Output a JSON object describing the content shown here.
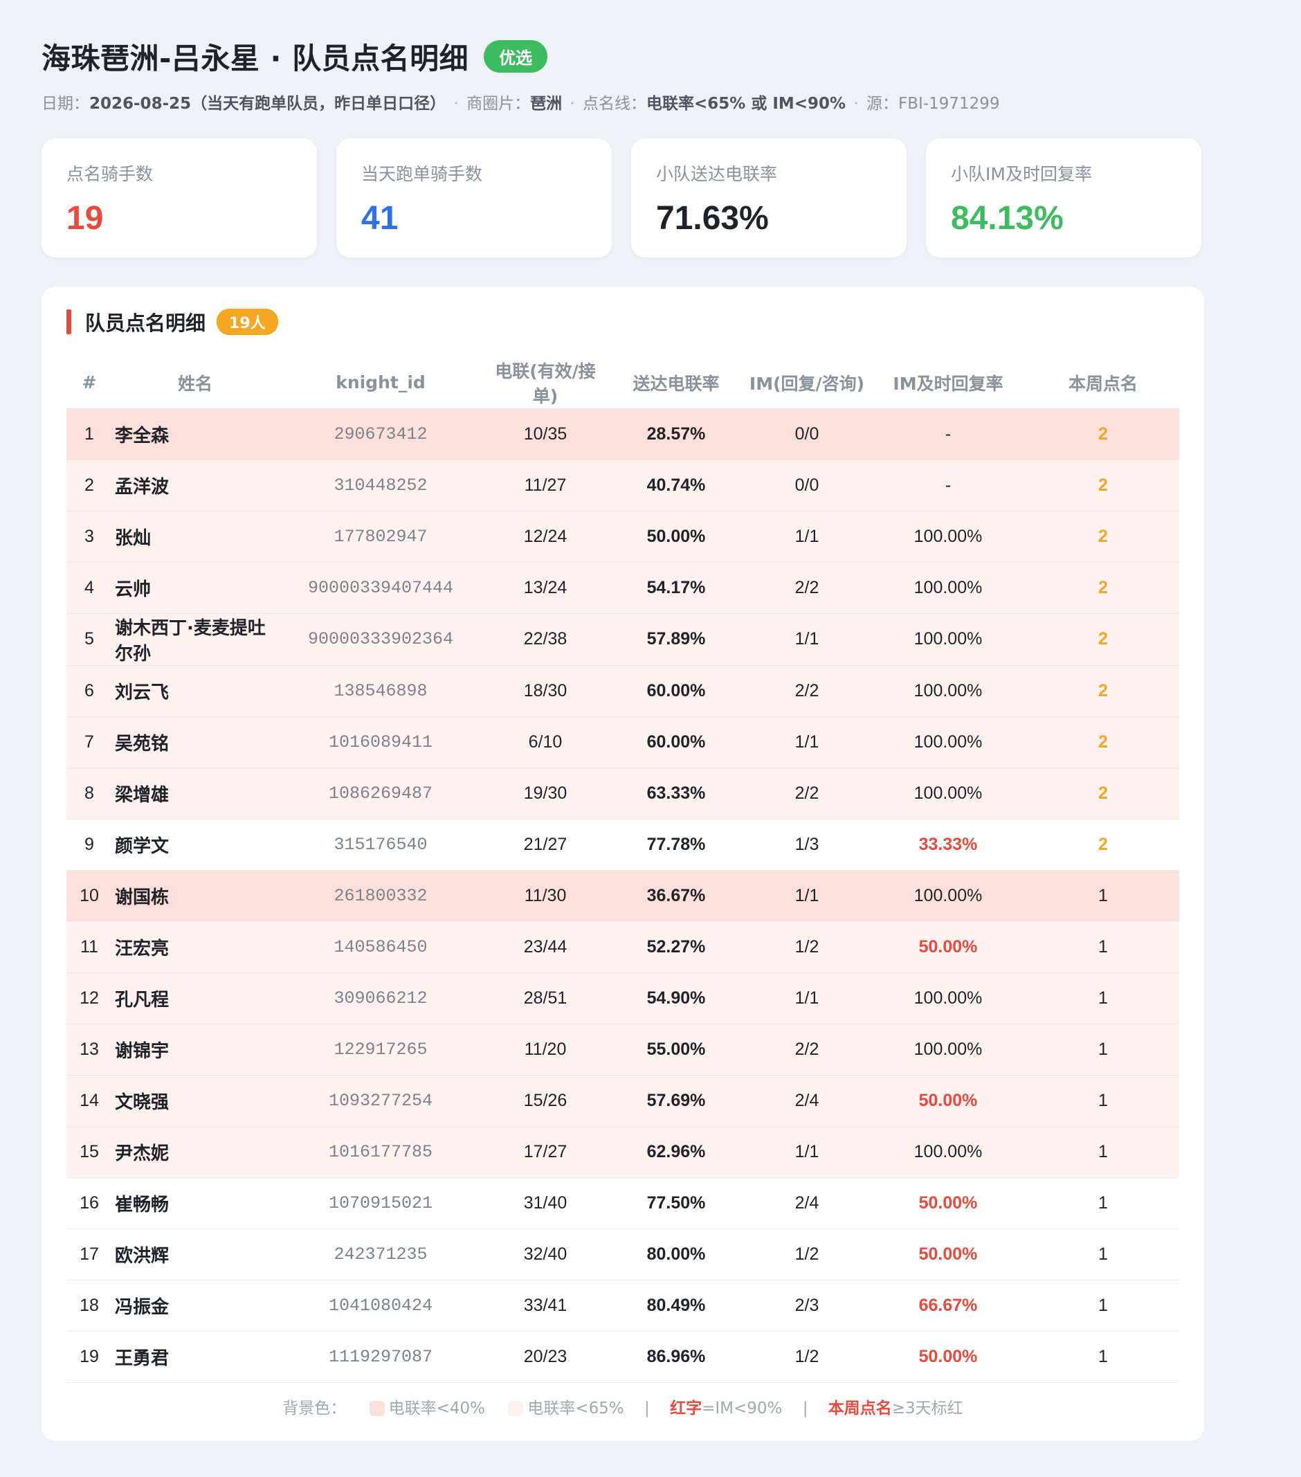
{
  "header": {
    "title": "海珠琶洲-吕永星 · 队员点名明细",
    "badge": "优选",
    "meta": {
      "date_label": "日期：",
      "date_value": "2026-08-25（当天有跑单队员，昨日单日口径）",
      "area_label": "商圈片：",
      "area_value": "琶洲",
      "line_label": "点名线：",
      "line_value": "电联率<65% 或 IM<90%",
      "src_label": "源：",
      "src_value": "FBI-1971299",
      "separator": "·"
    }
  },
  "cards": [
    {
      "label": "点名骑手数",
      "value": "19",
      "color": "#e84a3c"
    },
    {
      "label": "当天跑单骑手数",
      "value": "41",
      "color": "#2f6fe8"
    },
    {
      "label": "小队送达电联率",
      "value": "71.63%",
      "color": "#1f2329"
    },
    {
      "label": "小队IM及时回复率",
      "value": "84.13%",
      "color": "#3dbb5f"
    }
  ],
  "panel": {
    "title": "队员点名明细",
    "count_badge": "19人"
  },
  "table": {
    "headers": [
      "#",
      "姓名",
      "knight_id",
      "电联(有效/接单)",
      "送达电联率",
      "IM(回复/咨询)",
      "IM及时回复率",
      "本周点名"
    ],
    "rows": [
      {
        "no": "1",
        "name": "李全森",
        "kid": "290673412",
        "call": "10/35",
        "rate": "28.57%",
        "im": "0/0",
        "im_rate": "-",
        "week": "2",
        "bg": "strong",
        "im_red": false,
        "week_orange": true
      },
      {
        "no": "2",
        "name": "孟洋波",
        "kid": "310448252",
        "call": "11/27",
        "rate": "40.74%",
        "im": "0/0",
        "im_rate": "-",
        "week": "2",
        "bg": "light",
        "im_red": false,
        "week_orange": true
      },
      {
        "no": "3",
        "name": "张灿",
        "kid": "177802947",
        "call": "12/24",
        "rate": "50.00%",
        "im": "1/1",
        "im_rate": "100.00%",
        "week": "2",
        "bg": "light",
        "im_red": false,
        "week_orange": true
      },
      {
        "no": "4",
        "name": "云帅",
        "kid": "90000339407444",
        "call": "13/24",
        "rate": "54.17%",
        "im": "2/2",
        "im_rate": "100.00%",
        "week": "2",
        "bg": "light",
        "im_red": false,
        "week_orange": true
      },
      {
        "no": "5",
        "name": "谢木西丁·麦麦提吐尔孙",
        "kid": "90000333902364",
        "call": "22/38",
        "rate": "57.89%",
        "im": "1/1",
        "im_rate": "100.00%",
        "week": "2",
        "bg": "light",
        "im_red": false,
        "week_orange": true
      },
      {
        "no": "6",
        "name": "刘云飞",
        "kid": "138546898",
        "call": "18/30",
        "rate": "60.00%",
        "im": "2/2",
        "im_rate": "100.00%",
        "week": "2",
        "bg": "light",
        "im_red": false,
        "week_orange": true
      },
      {
        "no": "7",
        "name": "吴苑铭",
        "kid": "1016089411",
        "call": "6/10",
        "rate": "60.00%",
        "im": "1/1",
        "im_rate": "100.00%",
        "week": "2",
        "bg": "light",
        "im_red": false,
        "week_orange": true
      },
      {
        "no": "8",
        "name": "梁增雄",
        "kid": "1086269487",
        "call": "19/30",
        "rate": "63.33%",
        "im": "2/2",
        "im_rate": "100.00%",
        "week": "2",
        "bg": "light",
        "im_red": false,
        "week_orange": true
      },
      {
        "no": "9",
        "name": "颜学文",
        "kid": "315176540",
        "call": "21/27",
        "rate": "77.78%",
        "im": "1/3",
        "im_rate": "33.33%",
        "week": "2",
        "bg": "none",
        "im_red": true,
        "week_orange": true
      },
      {
        "no": "10",
        "name": "谢国栋",
        "kid": "261800332",
        "call": "11/30",
        "rate": "36.67%",
        "im": "1/1",
        "im_rate": "100.00%",
        "week": "1",
        "bg": "strong",
        "im_red": false,
        "week_orange": false
      },
      {
        "no": "11",
        "name": "汪宏亮",
        "kid": "140586450",
        "call": "23/44",
        "rate": "52.27%",
        "im": "1/2",
        "im_rate": "50.00%",
        "week": "1",
        "bg": "light",
        "im_red": true,
        "week_orange": false
      },
      {
        "no": "12",
        "name": "孔凡程",
        "kid": "309066212",
        "call": "28/51",
        "rate": "54.90%",
        "im": "1/1",
        "im_rate": "100.00%",
        "week": "1",
        "bg": "light",
        "im_red": false,
        "week_orange": false
      },
      {
        "no": "13",
        "name": "谢锦宇",
        "kid": "122917265",
        "call": "11/20",
        "rate": "55.00%",
        "im": "2/2",
        "im_rate": "100.00%",
        "week": "1",
        "bg": "light",
        "im_red": false,
        "week_orange": false
      },
      {
        "no": "14",
        "name": "文晓强",
        "kid": "1093277254",
        "call": "15/26",
        "rate": "57.69%",
        "im": "2/4",
        "im_rate": "50.00%",
        "week": "1",
        "bg": "light",
        "im_red": true,
        "week_orange": false
      },
      {
        "no": "15",
        "name": "尹杰妮",
        "kid": "1016177785",
        "call": "17/27",
        "rate": "62.96%",
        "im": "1/1",
        "im_rate": "100.00%",
        "week": "1",
        "bg": "light",
        "im_red": false,
        "week_orange": false
      },
      {
        "no": "16",
        "name": "崔畅畅",
        "kid": "1070915021",
        "call": "31/40",
        "rate": "77.50%",
        "im": "2/4",
        "im_rate": "50.00%",
        "week": "1",
        "bg": "none",
        "im_red": true,
        "week_orange": false
      },
      {
        "no": "17",
        "name": "欧洪辉",
        "kid": "242371235",
        "call": "32/40",
        "rate": "80.00%",
        "im": "1/2",
        "im_rate": "50.00%",
        "week": "1",
        "bg": "none",
        "im_red": true,
        "week_orange": false
      },
      {
        "no": "18",
        "name": "冯振金",
        "kid": "1041080424",
        "call": "33/41",
        "rate": "80.49%",
        "im": "2/3",
        "im_rate": "66.67%",
        "week": "1",
        "bg": "none",
        "im_red": true,
        "week_orange": false
      },
      {
        "no": "19",
        "name": "王勇君",
        "kid": "1119297087",
        "call": "20/23",
        "rate": "86.96%",
        "im": "1/2",
        "im_rate": "50.00%",
        "week": "1",
        "bg": "none",
        "im_red": true,
        "week_orange": false
      }
    ]
  },
  "legend": {
    "prefix": "背景色：",
    "item1": "电联率<40%",
    "item1_color": "#fde0dc",
    "item2": "电联率<65%",
    "item2_color": "#fff1ef",
    "pipe": "|",
    "red_key": "红字",
    "red_desc": "=IM<90%",
    "week_key": "本周点名",
    "week_desc": "≥3天标红"
  }
}
